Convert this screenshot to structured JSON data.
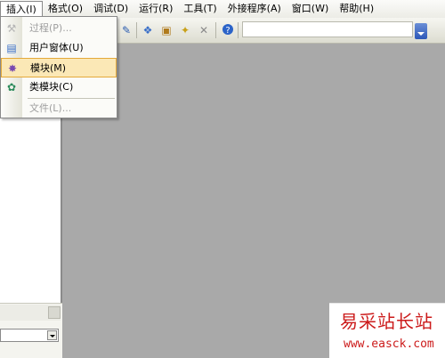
{
  "menubar": {
    "items": [
      {
        "label": "插入(I)"
      },
      {
        "label": "格式(O)"
      },
      {
        "label": "调试(D)"
      },
      {
        "label": "运行(R)"
      },
      {
        "label": "工具(T)"
      },
      {
        "label": "外接程序(A)"
      },
      {
        "label": "窗口(W)"
      },
      {
        "label": "帮助(H)"
      }
    ]
  },
  "insert_menu": {
    "items": [
      {
        "label": "过程(P)...",
        "icon": "procedure-icon",
        "enabled": false
      },
      {
        "label": "用户窗体(U)",
        "icon": "userform-icon",
        "enabled": true
      },
      {
        "label": "模块(M)",
        "icon": "module-icon",
        "enabled": true,
        "highlighted": true
      },
      {
        "label": "类模块(C)",
        "icon": "class-module-icon",
        "enabled": true
      },
      {
        "label": "文件(L)...",
        "icon": "file-icon",
        "enabled": false
      }
    ]
  },
  "toolbar": {
    "icons": [
      "design-mode-icon",
      "project-explorer-icon",
      "properties-window-icon",
      "object-browser-icon",
      "toolbox-icon",
      "help-icon"
    ]
  },
  "watermark": {
    "title": "易采站长站",
    "url": "www.easck.com"
  },
  "colors": {
    "highlight_bg": "#fbe8b6",
    "highlight_border": "#e4a93a",
    "workspace": "#a9a9a9",
    "watermark_text": "#cc1b1b"
  }
}
